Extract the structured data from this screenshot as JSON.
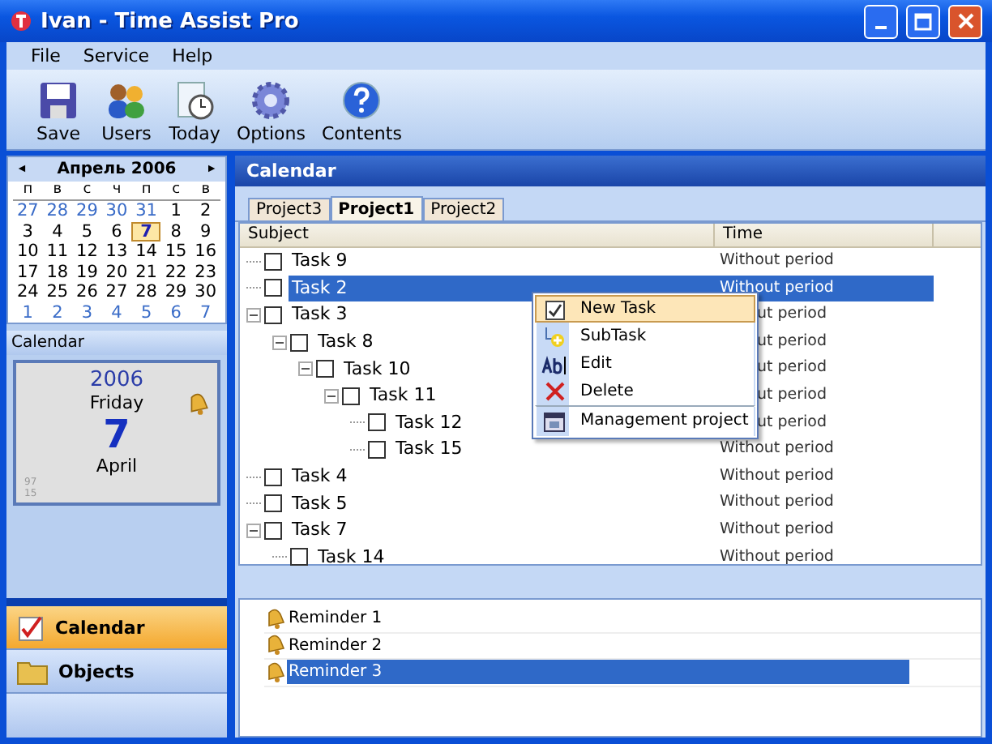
{
  "window": {
    "title": "Ivan - Time Assist Pro"
  },
  "menu": [
    "File",
    "Service",
    "Help"
  ],
  "toolbar": [
    {
      "kind": "save",
      "label": "Save"
    },
    {
      "kind": "users",
      "label": "Users"
    },
    {
      "kind": "today",
      "label": "Today"
    },
    {
      "kind": "options",
      "label": "Options"
    },
    {
      "kind": "contents",
      "label": "Contents"
    }
  ],
  "month_calendar": {
    "title": "Апрель 2006",
    "prev": "◄",
    "next": "►",
    "weekdays": [
      "п",
      "в",
      "с",
      "ч",
      "п",
      "с",
      "в"
    ],
    "weeks": [
      [
        {
          "day": "27",
          "other_month": true,
          "selected": false
        },
        {
          "day": "28",
          "other_month": true,
          "selected": false
        },
        {
          "day": "29",
          "other_month": true,
          "selected": false
        },
        {
          "day": "30",
          "other_month": true,
          "selected": false
        },
        {
          "day": "31",
          "other_month": true,
          "selected": false
        },
        {
          "day": "1",
          "other_month": false,
          "selected": false
        },
        {
          "day": "2",
          "other_month": false,
          "selected": false
        }
      ],
      [
        {
          "day": "3",
          "other_month": false,
          "selected": false
        },
        {
          "day": "4",
          "other_month": false,
          "selected": false
        },
        {
          "day": "5",
          "other_month": false,
          "selected": false
        },
        {
          "day": "6",
          "other_month": false,
          "selected": false
        },
        {
          "day": "7",
          "other_month": false,
          "selected": true
        },
        {
          "day": "8",
          "other_month": false,
          "selected": false
        },
        {
          "day": "9",
          "other_month": false,
          "selected": false
        }
      ],
      [
        {
          "day": "10",
          "other_month": false,
          "selected": false
        },
        {
          "day": "11",
          "other_month": false,
          "selected": false
        },
        {
          "day": "12",
          "other_month": false,
          "selected": false
        },
        {
          "day": "13",
          "other_month": false,
          "selected": false
        },
        {
          "day": "14",
          "other_month": false,
          "selected": false
        },
        {
          "day": "15",
          "other_month": false,
          "selected": false
        },
        {
          "day": "16",
          "other_month": false,
          "selected": false
        }
      ],
      [
        {
          "day": "17",
          "other_month": false,
          "selected": false
        },
        {
          "day": "18",
          "other_month": false,
          "selected": false
        },
        {
          "day": "19",
          "other_month": false,
          "selected": false
        },
        {
          "day": "20",
          "other_month": false,
          "selected": false
        },
        {
          "day": "21",
          "other_month": false,
          "selected": false
        },
        {
          "day": "22",
          "other_month": false,
          "selected": false
        },
        {
          "day": "23",
          "other_month": false,
          "selected": false
        }
      ],
      [
        {
          "day": "24",
          "other_month": false,
          "selected": false
        },
        {
          "day": "25",
          "other_month": false,
          "selected": false
        },
        {
          "day": "26",
          "other_month": false,
          "selected": false
        },
        {
          "day": "27",
          "other_month": false,
          "selected": false
        },
        {
          "day": "28",
          "other_month": false,
          "selected": false
        },
        {
          "day": "29",
          "other_month": false,
          "selected": false
        },
        {
          "day": "30",
          "other_month": false,
          "selected": false
        }
      ],
      [
        {
          "day": "1",
          "other_month": true,
          "selected": false
        },
        {
          "day": "2",
          "other_month": true,
          "selected": false
        },
        {
          "day": "3",
          "other_month": true,
          "selected": false
        },
        {
          "day": "4",
          "other_month": true,
          "selected": false
        },
        {
          "day": "5",
          "other_month": true,
          "selected": false
        },
        {
          "day": "6",
          "other_month": true,
          "selected": false
        },
        {
          "day": "7",
          "other_month": true,
          "selected": false
        }
      ]
    ]
  },
  "day_panel": {
    "title": "Calendar",
    "year": "2006",
    "weekday": "Friday",
    "day": "7",
    "month": "April",
    "note_1": "97",
    "note_2": "15"
  },
  "nav": [
    {
      "kind": "calendar",
      "label": "Calendar",
      "selected": true
    },
    {
      "kind": "objects",
      "label": "Objects",
      "selected": false
    }
  ],
  "main": {
    "title": "Calendar",
    "tabs": [
      {
        "label": "Project3",
        "selected": false
      },
      {
        "label": "Project1",
        "selected": true
      },
      {
        "label": "Project2",
        "selected": false
      }
    ],
    "columns": [
      "Subject",
      "Time"
    ],
    "tasks": [
      {
        "name": "Task 9",
        "time": "Without period",
        "checked": false,
        "selected": false,
        "covered": false
      },
      {
        "name": "Task 2",
        "time": "Without period",
        "checked": false,
        "selected": true,
        "covered": false
      },
      {
        "name": "Task 3",
        "time": "ut period",
        "checked": false,
        "selected": false,
        "covered": true,
        "expanded": true,
        "children": [
          {
            "name": "Task 8",
            "time": "ut period",
            "checked": false,
            "selected": false,
            "covered": true,
            "expanded": true,
            "children": [
              {
                "name": "Task 10",
                "time": "ut period",
                "checked": false,
                "selected": false,
                "covered": true,
                "expanded": true,
                "children": [
                  {
                    "name": "Task 11",
                    "time": "ut period",
                    "checked": false,
                    "selected": false,
                    "covered": true,
                    "expanded": true,
                    "children": [
                      {
                        "name": "Task 12",
                        "time": "ut period",
                        "checked": false,
                        "selected": false,
                        "covered": true
                      },
                      {
                        "name": "Task 15",
                        "time": "Without period",
                        "checked": false,
                        "selected": false,
                        "covered": false
                      }
                    ]
                  }
                ]
              }
            ]
          }
        ]
      },
      {
        "name": "Task 4",
        "time": "Without period",
        "checked": false,
        "selected": false,
        "covered": false
      },
      {
        "name": "Task 5",
        "time": "Without period",
        "checked": false,
        "selected": false,
        "covered": false
      },
      {
        "name": "Task 7",
        "time": "Without period",
        "checked": false,
        "selected": false,
        "covered": false,
        "expanded": true,
        "children": [
          {
            "name": "Task 14",
            "time": "Without period",
            "checked": false,
            "selected": false,
            "covered": false
          }
        ]
      }
    ],
    "context_menu": [
      {
        "kind": "new",
        "label": "New Task",
        "selected": true
      },
      {
        "kind": "subtask",
        "label": "SubTask",
        "selected": false
      },
      {
        "kind": "edit",
        "label": "Edit",
        "selected": false
      },
      {
        "kind": "delete",
        "label": "Delete",
        "selected": false
      },
      {
        "kind": "manage",
        "label": "Management project",
        "selected": false
      }
    ],
    "reminders": [
      {
        "label": "Reminder 1",
        "selected": false
      },
      {
        "label": "Reminder 2",
        "selected": false
      },
      {
        "label": "Reminder 3",
        "selected": true
      }
    ]
  }
}
